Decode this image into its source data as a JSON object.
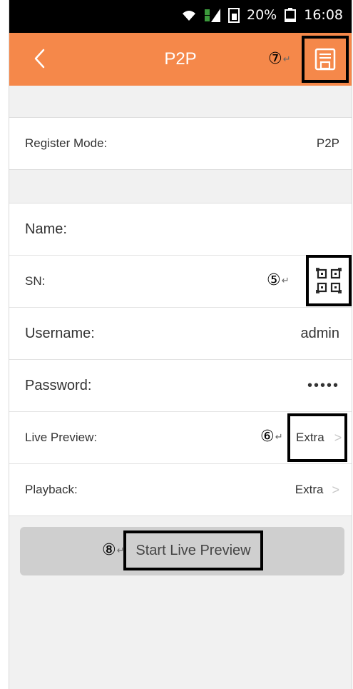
{
  "status_bar": {
    "battery": "20%",
    "time": "16:08",
    "icons": [
      "wifi-icon",
      "signal-icon",
      "sim-icon",
      "battery-icon"
    ]
  },
  "nav": {
    "title": "P2P",
    "back_icon": "chevron-left-icon",
    "save_icon": "save-icon",
    "accent": "#f5884a"
  },
  "annotations": {
    "save": "⑦",
    "sn_scan": "⑤",
    "live_preview": "⑥",
    "start": "⑧"
  },
  "register": {
    "label": "Register Mode:",
    "value": "P2P"
  },
  "fields": {
    "name_label": "Name:",
    "name_value": "",
    "sn_label": "SN:",
    "username_label": "Username:",
    "username_value": "admin",
    "password_label": "Password:",
    "password_value": "•••••",
    "live_preview_label": "Live Preview:",
    "live_preview_value": "Extra",
    "playback_label": "Playback:",
    "playback_value": "Extra"
  },
  "actions": {
    "start_label": "Start Live Preview"
  }
}
